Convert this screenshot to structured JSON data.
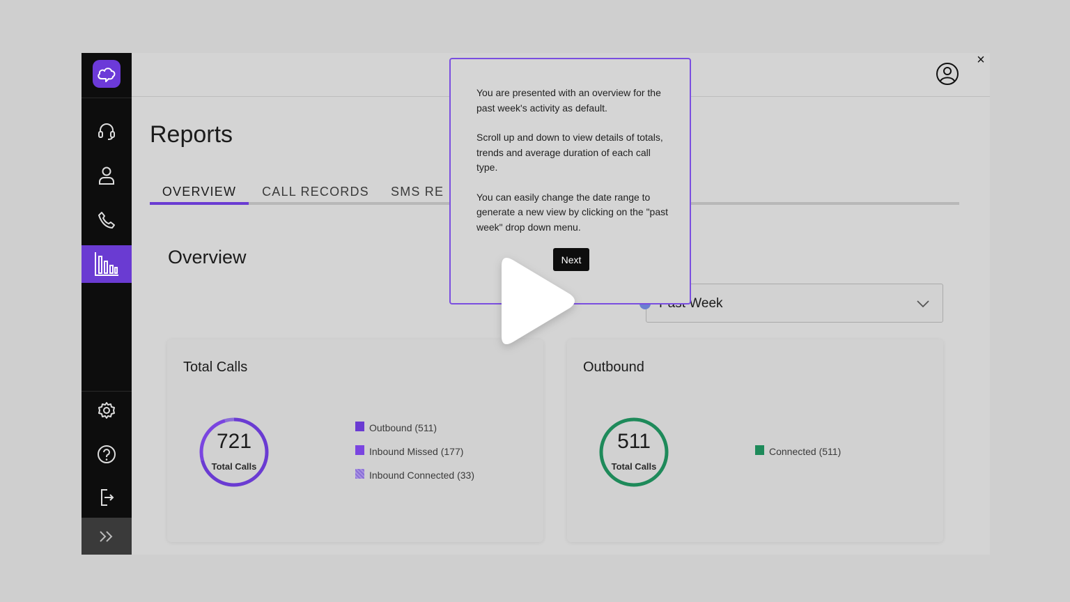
{
  "colors": {
    "accent": "#6a3bd2",
    "outbound": "#6a3bd2",
    "inbound_missed": "#7a45e0",
    "inbound_connected": "#8b6fd8",
    "connected": "#1e8a5a",
    "sidebar_bg": "#0d0d0d"
  },
  "sidebar": {
    "logo_icon": "cloud-icon",
    "items": [
      {
        "icon": "headset-icon",
        "active": false
      },
      {
        "icon": "person-icon",
        "active": false
      },
      {
        "icon": "phone-icon",
        "active": false
      },
      {
        "icon": "bar-chart-icon",
        "active": true
      }
    ],
    "bottom_items": [
      {
        "icon": "gear-icon"
      },
      {
        "icon": "help-icon"
      },
      {
        "icon": "logout-icon"
      }
    ],
    "expand_icon": "double-chevron-right-icon"
  },
  "topbar": {
    "profile_icon": "user-circle-icon",
    "close_label": "×"
  },
  "page": {
    "title": "Reports"
  },
  "tabs": [
    {
      "label": "OVERVIEW",
      "active": true
    },
    {
      "label": "CALL RECORDS",
      "active": false
    },
    {
      "label": "SMS RE",
      "active": false
    }
  ],
  "overview": {
    "title": "Overview",
    "date_range": "Past Week"
  },
  "cards": {
    "total_calls": {
      "title": "Total Calls",
      "total": "721",
      "total_label": "Total Calls",
      "legend": [
        {
          "label": "Outbound (511)",
          "value": 511
        },
        {
          "label": "Inbound Missed (177)",
          "value": 177
        },
        {
          "label": "Inbound Connected (33)",
          "value": 33
        }
      ]
    },
    "outbound": {
      "title": "Outbound",
      "total": "511",
      "total_label": "Total Calls",
      "legend": [
        {
          "label": "Connected (511)",
          "value": 511
        }
      ]
    }
  },
  "popup": {
    "paragraphs": [
      "You are presented with an overview for the past week's activity as default.",
      "Scroll up and down to view details of totals, trends and average duration of each call type.",
      "You can easily change the date range to generate a new view by clicking on the \"past week\" drop down menu."
    ],
    "next_label": "Next"
  },
  "overlay": {
    "play_icon": "play-icon"
  }
}
